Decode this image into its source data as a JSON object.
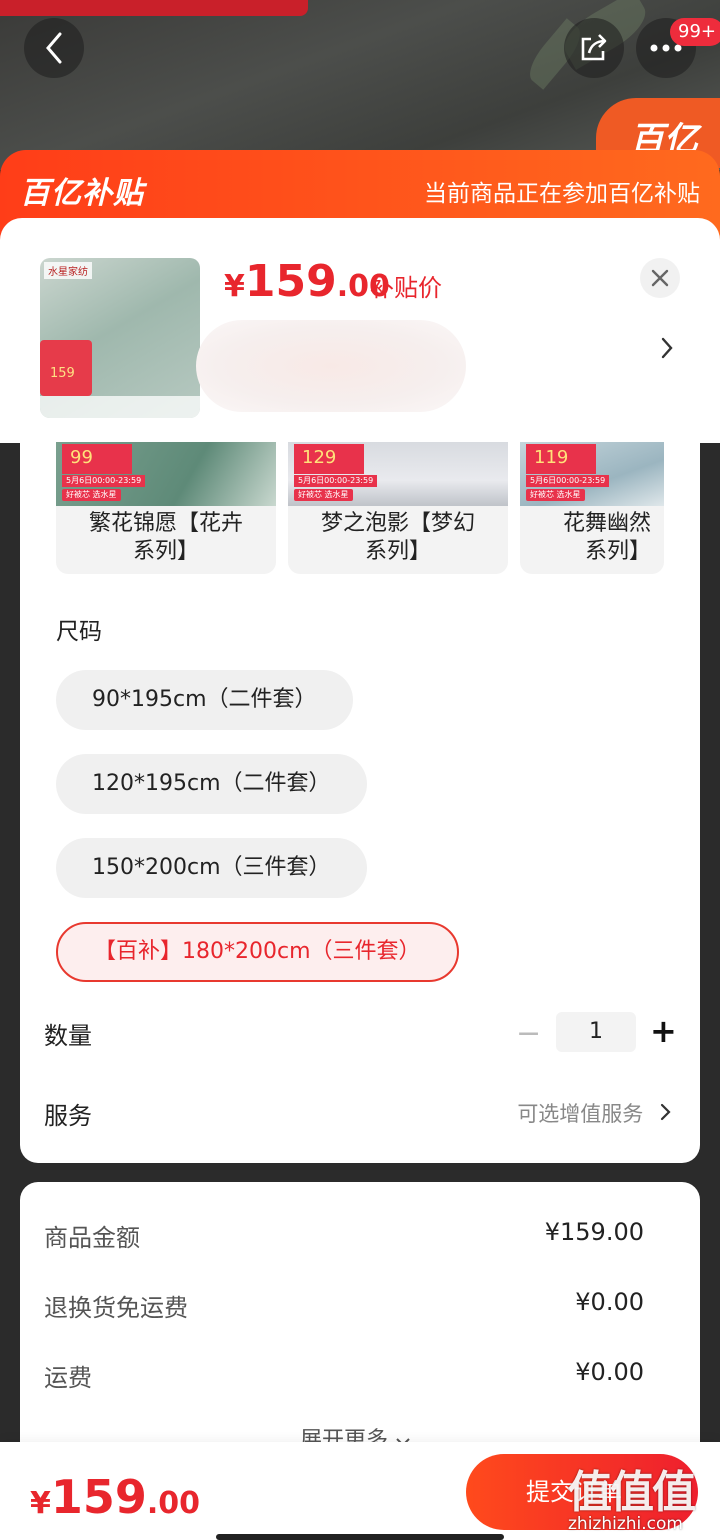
{
  "header": {
    "badge": "99+",
    "brand_corner": "百亿"
  },
  "banner": {
    "logo": "百亿补贴",
    "notice": "当前商品正在参加百亿补贴"
  },
  "product": {
    "thumb_brand": "水星家纺",
    "thumb_price": "159",
    "price_yen": "¥",
    "price_int": "159",
    "price_dec": ".00",
    "price_tag": "补贴价"
  },
  "variants": [
    {
      "price": "99",
      "date": "5月6日00:00-23:59",
      "tag": "好被芯 选水星",
      "name_line1": "繁花锦愿【花卉",
      "name_line2": "系列】"
    },
    {
      "price": "129",
      "date": "5月6日00:00-23:59",
      "tag": "好被芯 选水星",
      "name_line1": "梦之泡影【梦幻",
      "name_line2": "系列】"
    },
    {
      "price": "119",
      "date": "5月6日00:00-23:59",
      "tag": "好被芯 选水星",
      "name_line1": "花舞幽然【",
      "name_line2": "系列】"
    }
  ],
  "size": {
    "label": "尺码",
    "options": [
      "90*195cm（二件套）",
      "120*195cm（二件套）",
      "150*200cm（三件套）",
      "【百补】180*200cm（三件套）"
    ],
    "selected_index": 3
  },
  "quantity": {
    "label": "数量",
    "value": "1",
    "minus": "−",
    "plus": "+"
  },
  "service": {
    "label": "服务",
    "value": "可选增值服务"
  },
  "summary": {
    "rows": [
      {
        "label": "商品金额",
        "value": "¥159.00"
      },
      {
        "label": "退换货免运费",
        "value": "¥0.00"
      },
      {
        "label": "运费",
        "value": "¥0.00"
      }
    ],
    "expand": "展开更多"
  },
  "footer": {
    "price_yen": "¥",
    "price_int": "159",
    "price_dec": ".00",
    "submit": "提交订单",
    "watermark": "值值值",
    "watermark_sub": "zhizhizhi.com"
  },
  "colors": {
    "accent": "#e8262d",
    "banner": "#ff4a1c"
  }
}
